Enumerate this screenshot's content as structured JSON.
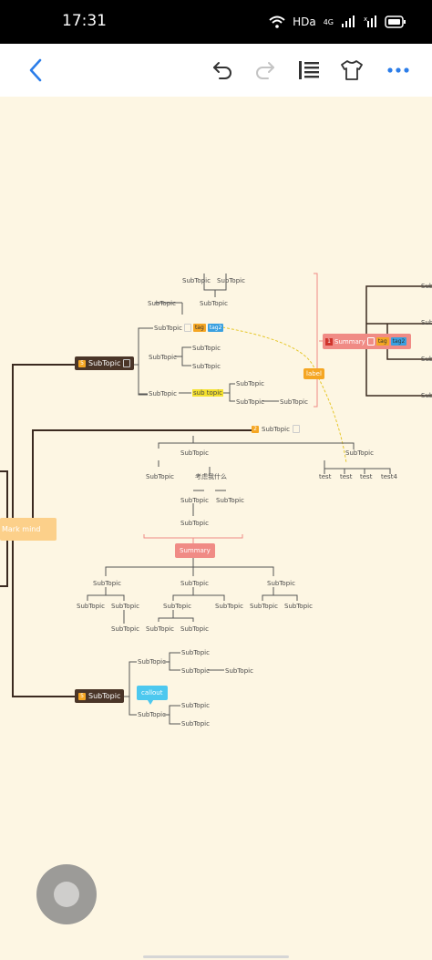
{
  "status_bar": {
    "time": "17:31",
    "network": "HDa",
    "cell": "4G"
  },
  "toolbar": {
    "back_icon": "chevron-left-icon",
    "undo_icon": "undo-icon",
    "redo_icon": "redo-icon",
    "outline_icon": "outline-icon",
    "theme_icon": "tshirt-icon",
    "more_icon": "more-icon"
  },
  "mindmap": {
    "root": "Mark mind",
    "main_topics": [
      "SubTopic",
      "SubTopic",
      "SubTopic"
    ],
    "badges": [
      "5",
      "2",
      "5",
      "1"
    ],
    "label": "label",
    "callout": "callout",
    "summary_right": "Summary",
    "summary_mid": "Summary",
    "tags": [
      "tag",
      "tag2"
    ],
    "top_cluster": [
      "SubTopic",
      "SubTopic",
      "SubTopic",
      "SubTopic",
      "SubTopic",
      "SubTopic",
      "SubTopic",
      "SubTopic",
      "SubTopic",
      "sub topic",
      "SubTopic",
      "SubTopic"
    ],
    "test_nodes": [
      "test",
      "test",
      "test",
      "test4"
    ],
    "chinese_node": "考虑我什么",
    "mid_cluster": [
      "SubTopic",
      "SubTopic",
      "SubTopic",
      "SubTopic",
      "SubTopic",
      "SubTopic",
      "SubTopic",
      "SubTopic",
      "SubTopic",
      "SubTopic",
      "SubTopic",
      "SubTopic",
      "SubTopic",
      "SubTopic",
      "SubTopic",
      "SubTopic",
      "SubTopic"
    ],
    "bottom_cluster": [
      "SubTopic",
      "SubTopic",
      "SubTopic",
      "SubTopic",
      "SubTopic",
      "SubTopic",
      "SubTopic"
    ],
    "right_edge": [
      "Sub",
      "Sub",
      "Sub",
      "Sub"
    ]
  },
  "colors": {
    "canvas": "#fdf6e3",
    "main_node": "#4a3528",
    "root": "#fcd08a",
    "summary": "#f08b85",
    "label": "#f5a623",
    "callout": "#4dc8ef",
    "tag_orange": "#f5a623",
    "tag_blue": "#3aa0e0",
    "highlight": "#f5e12d"
  }
}
